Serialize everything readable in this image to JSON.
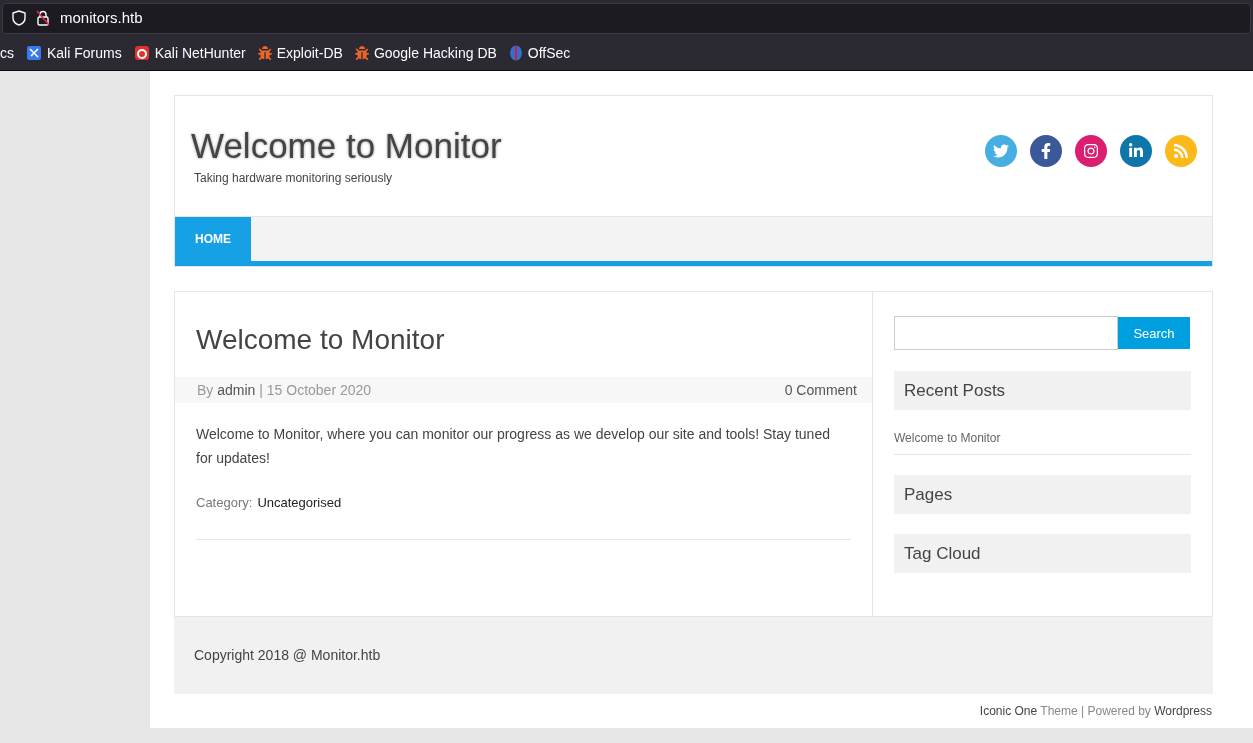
{
  "browser": {
    "url": "monitors.htb",
    "bookmarks": [
      {
        "label": "cs",
        "kind": "none"
      },
      {
        "label": "Kali Forums",
        "kind": "forums"
      },
      {
        "label": "Kali NetHunter",
        "kind": "nethunter"
      },
      {
        "label": "Exploit-DB",
        "kind": "bug"
      },
      {
        "label": "Google Hacking DB",
        "kind": "bug"
      },
      {
        "label": "OffSec",
        "kind": "offsec"
      }
    ]
  },
  "site": {
    "title": "Welcome to Monitor",
    "tagline": "Taking hardware monitoring seriously",
    "social": [
      {
        "kind": "twitter",
        "color": "#47aee4"
      },
      {
        "kind": "facebook",
        "color": "#3b5998"
      },
      {
        "kind": "instagram",
        "color": "#dc1e71"
      },
      {
        "kind": "linkedin",
        "color": "#0e76a8"
      },
      {
        "kind": "rss",
        "color": "#fbb91c"
      }
    ],
    "nav": [
      {
        "label": "HOME",
        "selected": true
      }
    ]
  },
  "post": {
    "title": "Welcome to Monitor",
    "by": "By",
    "author": "admin",
    "date": "| 15 October 2020",
    "comments": "0 Comment",
    "body": "Welcome to Monitor, where you can monitor our progress as we develop our site and tools! Stay tuned for updates!",
    "category_label": "Category:",
    "category": "Uncategorised"
  },
  "sidebar": {
    "search_button": "Search",
    "widgets": [
      {
        "title": "Recent Posts",
        "links": [
          "Welcome to Monitor"
        ]
      },
      {
        "title": "Pages"
      },
      {
        "title": "Tag Cloud"
      }
    ]
  },
  "footer": {
    "copyright": "Copyright 2018 @ Monitor.htb",
    "theme": "Iconic One",
    "theme_word": "Theme | Powered by",
    "platform": "Wordpress"
  }
}
